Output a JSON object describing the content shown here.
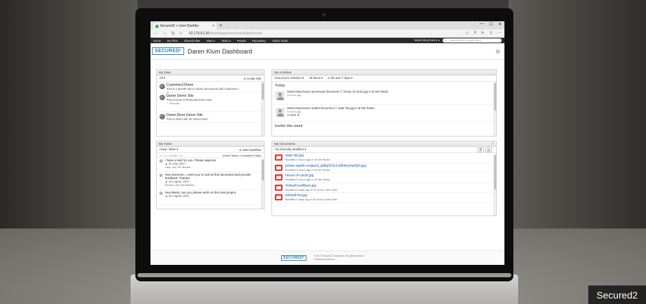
{
  "browser": {
    "tab_title": "Secured2 » User Dashbo",
    "tab_close": "×",
    "tab_new": "+",
    "window_controls": [
      "—",
      "☐",
      "✕"
    ],
    "nav_back": "←",
    "nav_forward": "→",
    "nav_refresh": "↻",
    "nav_home": "⌂",
    "url_host": "52.176.61.30",
    "url_path": "/share/page/user/marat/dashboard",
    "address_icons": [
      "☆",
      "≡",
      "✎",
      "⇪",
      "···"
    ]
  },
  "appnav": {
    "items": [
      "Home",
      "My Files",
      "Shared Files",
      "Sites ▾",
      "Tasks ▾",
      "People",
      "Repository",
      "Admin Tools"
    ],
    "user": "Marat Meyrmanov ▾",
    "search_placeholder": "Search files, people, sites",
    "search_icon": "⌕"
  },
  "header": {
    "logo": "SECURED²",
    "title": "Daren Klum Dashboard",
    "gear": "⚙"
  },
  "sites": {
    "title": "My Sites",
    "filter": "All ▾",
    "create": "Create Site",
    "items": [
      {
        "name": "Customer1Share",
        "desc": "This is a private site to share documents with Customer1",
        "fav": "★"
      },
      {
        "name": "Daren Demo Site",
        "desc": "This is Daren's Personal Demo Site",
        "fav": "☆ Favorite"
      },
      {
        "name": "Daren.Klum Demo Site",
        "desc": "This is demo site for Daren.Klum",
        "fav": ""
      }
    ]
  },
  "activities": {
    "title": "My Activities",
    "filters": [
      "Everyone's activities ▾",
      "all items ▾",
      "in the last 7 days ▾"
    ],
    "today": "Today",
    "earlier": "Earlier this week",
    "items": [
      {
        "text": "Marat Meyrmanov previewed document ☐ house-of-cards.jpg in ⊕ Net Radio",
        "meta": "5 hours ago",
        "more": ""
      },
      {
        "text": "Marat Meyrmanov added document ☐ state fair.jpg in ⊕ Net Radio",
        "meta": "5 hours ago",
        "more": "2 more ▼"
      }
    ]
  },
  "tasks": {
    "title": "My Tasks",
    "filter": "Active Tasks ▾",
    "start": "Start Workflow",
    "pager": "<< < 1 - 6 of 6 > >>",
    "links": "Active Tasks | Completed Tasks",
    "items": [
      {
        "desc": "I have a task for you. Please approve",
        "date": "31 July, 2017",
        "status": "Task, Not Yet Started"
      },
      {
        "desc": "Hey everyone, I need you to look at this document and provide feedback. Thanks!",
        "date": "23 August, 2017",
        "status": "Review, Not Yet Started"
      },
      {
        "desc": "Hey Marat, can you please work on this new project.",
        "date": "25 August, 2017",
        "status": ""
      }
    ]
  },
  "documents": {
    "title": "My Documents",
    "help": "?",
    "filter": "I've Recently Modified ▾",
    "view_icons": [
      "≣",
      "▤"
    ],
    "items": [
      {
        "name": "state fair.jpg",
        "meta": "Modified 5 hours ago in ⊕ Net Radio"
      },
      {
        "name": "jordan-spieth-cropped_ip8jqt2r0c1uh84myhwt2ph.jpg",
        "meta": "Modified 5 hours ago in ⊕ Net Radio"
      },
      {
        "name": "house-of-cards.jpg",
        "meta": "Modified 5 hours ago in ⊕ Net Radio"
      },
      {
        "name": "YellowFrontBack.jpg",
        "meta": "Modified 5 days ago in ⊕ Demo Client Site"
      },
      {
        "name": "yellowfront.jpg",
        "meta": "Modified 5 days ago in ⊕ Demo Client Site"
      }
    ]
  },
  "footer": {
    "logo": "SECURED²",
    "copyright": "© 2017 Secured2 Corporation. All rights reserved.",
    "powered": "Powered by Alfresco."
  },
  "badge": "Secured2"
}
